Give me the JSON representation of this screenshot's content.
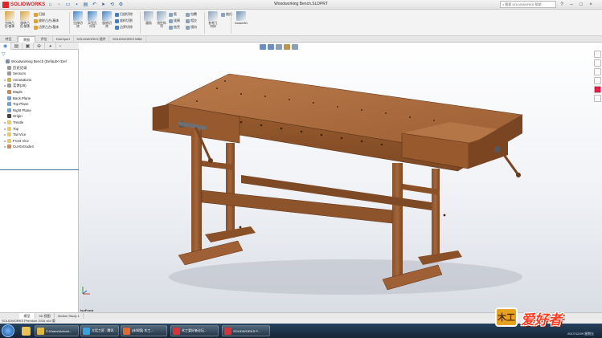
{
  "app": {
    "logo_text": "SOLIDWORKS",
    "document_title": "Woodworking Bench.SLDPRT",
    "search_placeholder": "搜索 SOLIDWORKS 帮助",
    "window_controls": [
      "?",
      "–",
      "□",
      "×"
    ]
  },
  "ribbon": {
    "big_buttons": [
      {
        "label": "拉伸凸\n台/基体",
        "color": "#d9a23a"
      },
      {
        "label": "旋转凸\n台/基体",
        "color": "#d9a23a"
      },
      {
        "label": "拉伸切\n除",
        "color": "#3f82c8"
      },
      {
        "label": "异型孔\n向导",
        "color": "#3f82c8"
      },
      {
        "label": "旋转切\n除",
        "color": "#3f82c8"
      },
      {
        "label": "圆角",
        "color": "#8aa2bb"
      },
      {
        "label": "线性阵\n列",
        "color": "#8aa2bb"
      },
      {
        "label": "参考几\n何体",
        "color": "#8aa2bb"
      },
      {
        "label": "Instant3D",
        "color": "#6e8fb0"
      }
    ],
    "small_buttons": [
      "扫描",
      "放样凸台/基体",
      "边界凸台/基体",
      "扫描切除",
      "放样切割",
      "边界切除",
      "筋",
      "拔模",
      "抽壳",
      "包覆",
      "相交",
      "镜向",
      "曲线"
    ]
  },
  "command_tabs": [
    "特征",
    "草图",
    "评估",
    "DimXpert",
    "SOLIDWORKS 插件",
    "SOLIDWORKS MBD"
  ],
  "feature_manager": {
    "tabs": [
      "feature-tree",
      "property",
      "config",
      "dimxpert",
      "display"
    ],
    "tree": [
      {
        "label": "Woodworking Bench  (Default<<Def",
        "icon": "#7b8fb0",
        "expander": ""
      },
      {
        "label": "历史记录",
        "icon": "#9a9a9a",
        "expander": ""
      },
      {
        "label": "Sensors",
        "icon": "#9a9a9a",
        "expander": ""
      },
      {
        "label": "Annotations",
        "icon": "#d2b24a",
        "expander": "▸"
      },
      {
        "label": "实体(29)",
        "icon": "#9a9a9a",
        "expander": "▸"
      },
      {
        "label": "Maple",
        "icon": "#c78a4c",
        "expander": ""
      },
      {
        "label": "Back Plane",
        "icon": "#7aa0cf",
        "expander": ""
      },
      {
        "label": "Top Plane",
        "icon": "#7aa0cf",
        "expander": ""
      },
      {
        "label": "Right Plane",
        "icon": "#7aa0cf",
        "expander": ""
      },
      {
        "label": "Origin",
        "icon": "#444444",
        "expander": ""
      },
      {
        "label": "Trestle",
        "icon": "#e8c86a",
        "expander": "▸"
      },
      {
        "label": "Top",
        "icon": "#e8c86a",
        "expander": "▸"
      },
      {
        "label": "Tail Vice",
        "icon": "#e8c86a",
        "expander": "▸"
      },
      {
        "label": "Front Vice",
        "icon": "#e8c86a",
        "expander": "▸"
      },
      {
        "label": "Cut-Extrude4",
        "icon": "#d28b4a",
        "expander": "▸"
      }
    ]
  },
  "viewport": {
    "view_orientation": "IsoFront"
  },
  "bottom_tabs": [
    "模型",
    "3D 视图",
    "Motion Study 1"
  ],
  "status_bar": "SOLIDWORKS Premium 2016 x64 版",
  "taskbar": {
    "items": [
      {
        "label": "C:\\Users\\Admini...",
        "color": "#e0b848"
      },
      {
        "label": "大话工匠 - 腾讯...",
        "color": "#3aa1e0"
      },
      {
        "label": "[未知版] 木工...",
        "color": "#e06a32"
      },
      {
        "label": "木工爱好者论坛...",
        "color": "#d7343a"
      },
      {
        "label": "SOLIDWORKS P...",
        "color": "#d7343a"
      }
    ],
    "clock": "2017/12/29 星期五"
  },
  "watermark": {
    "badge": "木工",
    "text": "爱好者"
  },
  "colors": {
    "wood_top": "#a8683b",
    "wood_front": "#8a522a",
    "wood_dark": "#6b3b1d",
    "accent_red": "#d8282e"
  }
}
